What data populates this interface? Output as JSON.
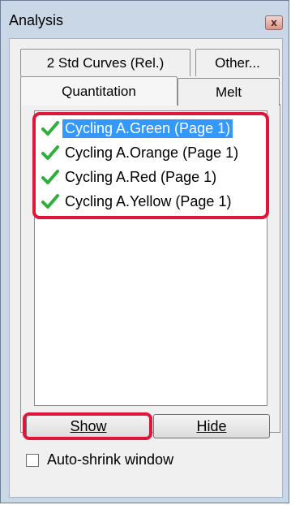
{
  "window": {
    "title": "Analysis",
    "close_glyph": "x"
  },
  "tabs": {
    "row1": [
      {
        "label": "2 Std Curves (Rel.)"
      },
      {
        "label": "Other..."
      }
    ],
    "row2": [
      {
        "label": "Quantitation",
        "active": true
      },
      {
        "label": "Melt"
      }
    ]
  },
  "list": {
    "items": [
      {
        "label": "Cycling A.Green (Page 1)",
        "checked": true,
        "selected": true
      },
      {
        "label": "Cycling A.Orange (Page 1)",
        "checked": true,
        "selected": false
      },
      {
        "label": "Cycling A.Red (Page 1)",
        "checked": true,
        "selected": false
      },
      {
        "label": "Cycling A.Yellow (Page 1)",
        "checked": true,
        "selected": false
      }
    ]
  },
  "buttons": {
    "show_label": "Show",
    "hide_label": "Hide"
  },
  "options": {
    "auto_shrink_label": "Auto-shrink window",
    "auto_shrink_checked": false
  },
  "colors": {
    "highlight": "#e0153a",
    "selection": "#3399ff",
    "check_green": "#2fae3c"
  }
}
